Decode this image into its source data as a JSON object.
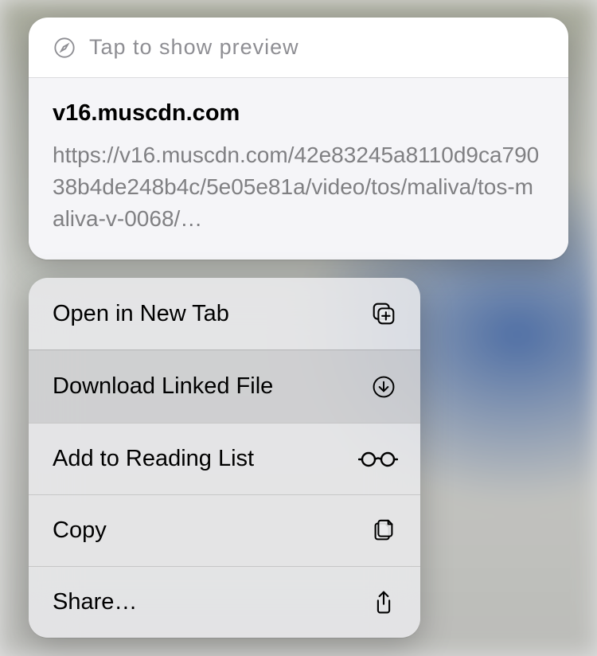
{
  "preview": {
    "tap_hint": "Tap to show preview",
    "domain": "v16.muscdn.com",
    "url": "https://v16.muscdn.com/​42e83245a8110d9ca79038b4de248b4c/​5e05e81a/video/tos/maliva/tos-maliva-v-0068/…"
  },
  "menu": {
    "open_new_tab": "Open in New Tab",
    "download": "Download Linked File",
    "reading_list": "Add to Reading List",
    "copy": "Copy",
    "share": "Share…"
  }
}
